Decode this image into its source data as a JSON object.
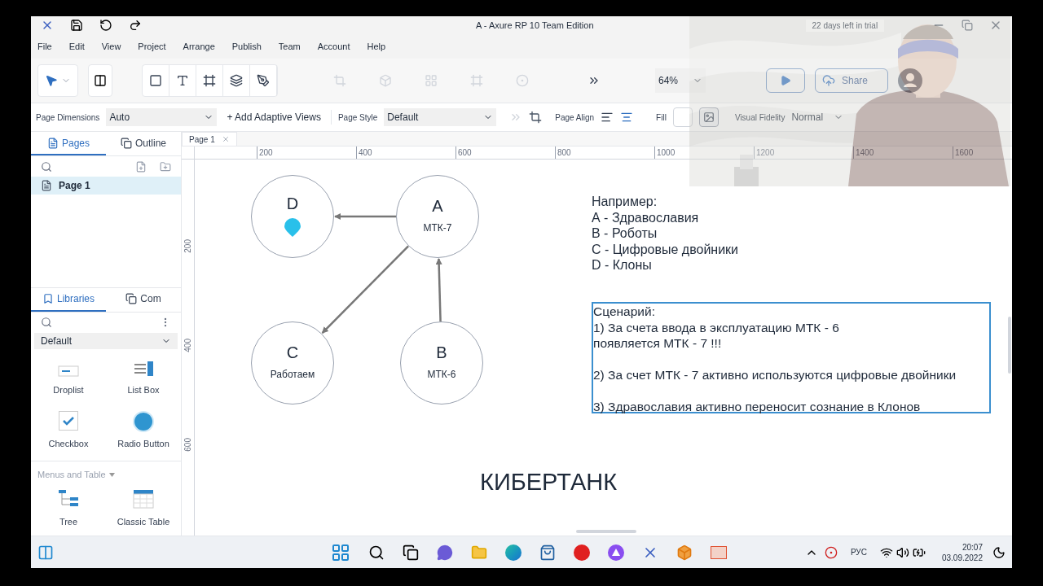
{
  "window": {
    "title": "A - Axure RP 10 Team Edition",
    "trial": "22 days left in trial"
  },
  "menu": [
    "File",
    "Edit",
    "View",
    "Project",
    "Arrange",
    "Publish",
    "Team",
    "Account",
    "Help"
  ],
  "toolbar": {
    "zoom": "64%",
    "share": "Share"
  },
  "page_bar": {
    "dimensions_label": "Page Dimensions",
    "dimensions": "Auto",
    "adaptive": "+ Add Adaptive Views",
    "style_label": "Page Style",
    "style": "Default",
    "align_label": "Page Align",
    "fill_label": "Fill",
    "fidelity_label": "Visual Fidelity",
    "fidelity": "Normal"
  },
  "left_panel": {
    "top_tabs": [
      {
        "label": "Pages",
        "selected": true
      },
      {
        "label": "Outline",
        "selected": false
      }
    ],
    "pages": [
      {
        "label": "Page 1",
        "selected": true
      }
    ],
    "bottom_tabs": [
      {
        "label": "Libraries",
        "selected": true
      },
      {
        "label": "Com",
        "selected": false
      }
    ],
    "library": "Default",
    "widgets": [
      {
        "kind": "droplist",
        "label": "Droplist"
      },
      {
        "kind": "listbox",
        "label": "List Box"
      },
      {
        "kind": "checkbox",
        "label": "Checkbox"
      },
      {
        "kind": "radio",
        "label": "Radio Button"
      }
    ],
    "section": "Menus and Table",
    "widgets2": [
      {
        "kind": "tree",
        "label": "Tree"
      },
      {
        "kind": "table",
        "label": "Classic Table"
      }
    ]
  },
  "canvas": {
    "tab": "Page 1",
    "h_ruler": [
      "200",
      "400",
      "600",
      "800",
      "1000",
      "1200",
      "1400",
      "1600"
    ],
    "v_ruler": [
      "200",
      "400",
      "600"
    ],
    "nodes": [
      {
        "kind": "marker",
        "letter": "D"
      },
      {
        "kind": "text",
        "letter": "A",
        "sub": "МТК-7"
      },
      {
        "kind": "text",
        "letter": "C",
        "sub": "Работаем"
      },
      {
        "kind": "text",
        "letter": "B",
        "sub": "МТК-6"
      }
    ],
    "legend": [
      "Например:",
      "А - Здравославия",
      "В - Роботы",
      "С - Цифровые двойники",
      "D - Клоны"
    ],
    "scenario": {
      "selected": true,
      "paragraphs": [
        {
          "lines": [
            "Сценарий:",
            "1) За счета ввода в эксплуатацию МТК - 6",
            "появляется МТК - 7 !!!"
          ]
        },
        {
          "lines": [
            "2) За счет МТК - 7 активно используются цифровые двойники"
          ]
        },
        {
          "lines": [
            "3) Здравославия активно переносит сознание в Клонов"
          ]
        }
      ]
    },
    "heading": "КИБЕРТАНК"
  },
  "taskbar": {
    "lang": "РУС",
    "time": "20:07",
    "date": "03.09.2022"
  }
}
